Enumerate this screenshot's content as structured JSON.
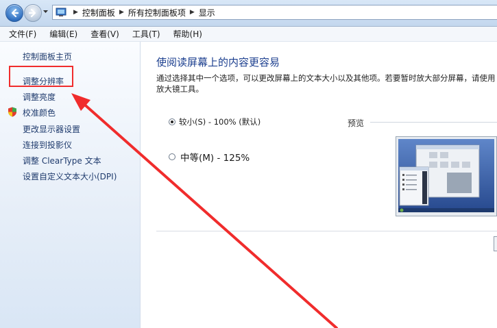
{
  "address_bar": {
    "crumbs": [
      "控制面板",
      "所有控制面板项",
      "显示"
    ]
  },
  "menu": {
    "items": [
      "文件(F)",
      "编辑(E)",
      "查看(V)",
      "工具(T)",
      "帮助(H)"
    ]
  },
  "sidebar": {
    "home": "控制面板主页",
    "items": [
      "调整分辨率",
      "调整亮度",
      "校准颜色",
      "更改显示器设置",
      "连接到投影仪",
      "调整 ClearType 文本",
      "设置自定义文本大小(DPI)"
    ]
  },
  "main": {
    "title": "使阅读屏幕上的内容更容易",
    "description": "通过选择其中一个选项，可以更改屏幕上的文本大小以及其他项。若要暂时放大部分屏幕，请使用放大镜工具。",
    "options": [
      {
        "label": "较小(S) - 100% (默认)",
        "selected": true
      },
      {
        "label": "中等(M) - 125%",
        "selected": false
      }
    ],
    "preview_label": "预览"
  },
  "colors": {
    "accent_title": "#1c3f8f",
    "link": "#1f3b6d",
    "annotation_red": "#f02c2c"
  }
}
